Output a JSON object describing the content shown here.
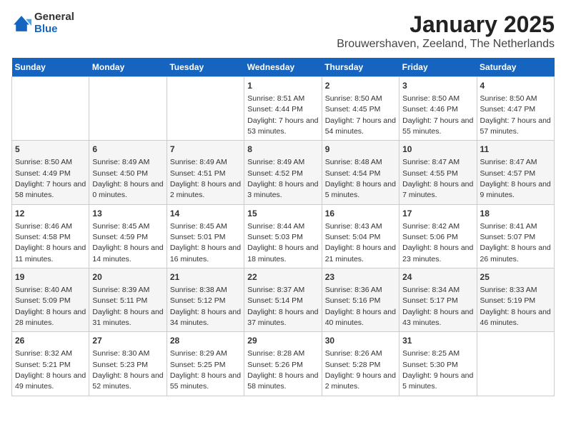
{
  "header": {
    "logo": {
      "general": "General",
      "blue": "Blue"
    },
    "title": "January 2025",
    "subtitle": "Brouwershaven, Zeeland, The Netherlands"
  },
  "weekdays": [
    "Sunday",
    "Monday",
    "Tuesday",
    "Wednesday",
    "Thursday",
    "Friday",
    "Saturday"
  ],
  "weeks": [
    [
      {
        "day": null
      },
      {
        "day": null
      },
      {
        "day": null
      },
      {
        "day": 1,
        "sunrise": "8:51 AM",
        "sunset": "4:44 PM",
        "daylight": "7 hours and 53 minutes."
      },
      {
        "day": 2,
        "sunrise": "8:50 AM",
        "sunset": "4:45 PM",
        "daylight": "7 hours and 54 minutes."
      },
      {
        "day": 3,
        "sunrise": "8:50 AM",
        "sunset": "4:46 PM",
        "daylight": "7 hours and 55 minutes."
      },
      {
        "day": 4,
        "sunrise": "8:50 AM",
        "sunset": "4:47 PM",
        "daylight": "7 hours and 57 minutes."
      }
    ],
    [
      {
        "day": 5,
        "sunrise": "8:50 AM",
        "sunset": "4:49 PM",
        "daylight": "7 hours and 58 minutes."
      },
      {
        "day": 6,
        "sunrise": "8:49 AM",
        "sunset": "4:50 PM",
        "daylight": "8 hours and 0 minutes."
      },
      {
        "day": 7,
        "sunrise": "8:49 AM",
        "sunset": "4:51 PM",
        "daylight": "8 hours and 2 minutes."
      },
      {
        "day": 8,
        "sunrise": "8:49 AM",
        "sunset": "4:52 PM",
        "daylight": "8 hours and 3 minutes."
      },
      {
        "day": 9,
        "sunrise": "8:48 AM",
        "sunset": "4:54 PM",
        "daylight": "8 hours and 5 minutes."
      },
      {
        "day": 10,
        "sunrise": "8:47 AM",
        "sunset": "4:55 PM",
        "daylight": "8 hours and 7 minutes."
      },
      {
        "day": 11,
        "sunrise": "8:47 AM",
        "sunset": "4:57 PM",
        "daylight": "8 hours and 9 minutes."
      }
    ],
    [
      {
        "day": 12,
        "sunrise": "8:46 AM",
        "sunset": "4:58 PM",
        "daylight": "8 hours and 11 minutes."
      },
      {
        "day": 13,
        "sunrise": "8:45 AM",
        "sunset": "4:59 PM",
        "daylight": "8 hours and 14 minutes."
      },
      {
        "day": 14,
        "sunrise": "8:45 AM",
        "sunset": "5:01 PM",
        "daylight": "8 hours and 16 minutes."
      },
      {
        "day": 15,
        "sunrise": "8:44 AM",
        "sunset": "5:03 PM",
        "daylight": "8 hours and 18 minutes."
      },
      {
        "day": 16,
        "sunrise": "8:43 AM",
        "sunset": "5:04 PM",
        "daylight": "8 hours and 21 minutes."
      },
      {
        "day": 17,
        "sunrise": "8:42 AM",
        "sunset": "5:06 PM",
        "daylight": "8 hours and 23 minutes."
      },
      {
        "day": 18,
        "sunrise": "8:41 AM",
        "sunset": "5:07 PM",
        "daylight": "8 hours and 26 minutes."
      }
    ],
    [
      {
        "day": 19,
        "sunrise": "8:40 AM",
        "sunset": "5:09 PM",
        "daylight": "8 hours and 28 minutes."
      },
      {
        "day": 20,
        "sunrise": "8:39 AM",
        "sunset": "5:11 PM",
        "daylight": "8 hours and 31 minutes."
      },
      {
        "day": 21,
        "sunrise": "8:38 AM",
        "sunset": "5:12 PM",
        "daylight": "8 hours and 34 minutes."
      },
      {
        "day": 22,
        "sunrise": "8:37 AM",
        "sunset": "5:14 PM",
        "daylight": "8 hours and 37 minutes."
      },
      {
        "day": 23,
        "sunrise": "8:36 AM",
        "sunset": "5:16 PM",
        "daylight": "8 hours and 40 minutes."
      },
      {
        "day": 24,
        "sunrise": "8:34 AM",
        "sunset": "5:17 PM",
        "daylight": "8 hours and 43 minutes."
      },
      {
        "day": 25,
        "sunrise": "8:33 AM",
        "sunset": "5:19 PM",
        "daylight": "8 hours and 46 minutes."
      }
    ],
    [
      {
        "day": 26,
        "sunrise": "8:32 AM",
        "sunset": "5:21 PM",
        "daylight": "8 hours and 49 minutes."
      },
      {
        "day": 27,
        "sunrise": "8:30 AM",
        "sunset": "5:23 PM",
        "daylight": "8 hours and 52 minutes."
      },
      {
        "day": 28,
        "sunrise": "8:29 AM",
        "sunset": "5:25 PM",
        "daylight": "8 hours and 55 minutes."
      },
      {
        "day": 29,
        "sunrise": "8:28 AM",
        "sunset": "5:26 PM",
        "daylight": "8 hours and 58 minutes."
      },
      {
        "day": 30,
        "sunrise": "8:26 AM",
        "sunset": "5:28 PM",
        "daylight": "9 hours and 2 minutes."
      },
      {
        "day": 31,
        "sunrise": "8:25 AM",
        "sunset": "5:30 PM",
        "daylight": "9 hours and 5 minutes."
      },
      {
        "day": null
      }
    ]
  ],
  "labels": {
    "sunrise": "Sunrise:",
    "sunset": "Sunset:",
    "daylight": "Daylight:"
  }
}
